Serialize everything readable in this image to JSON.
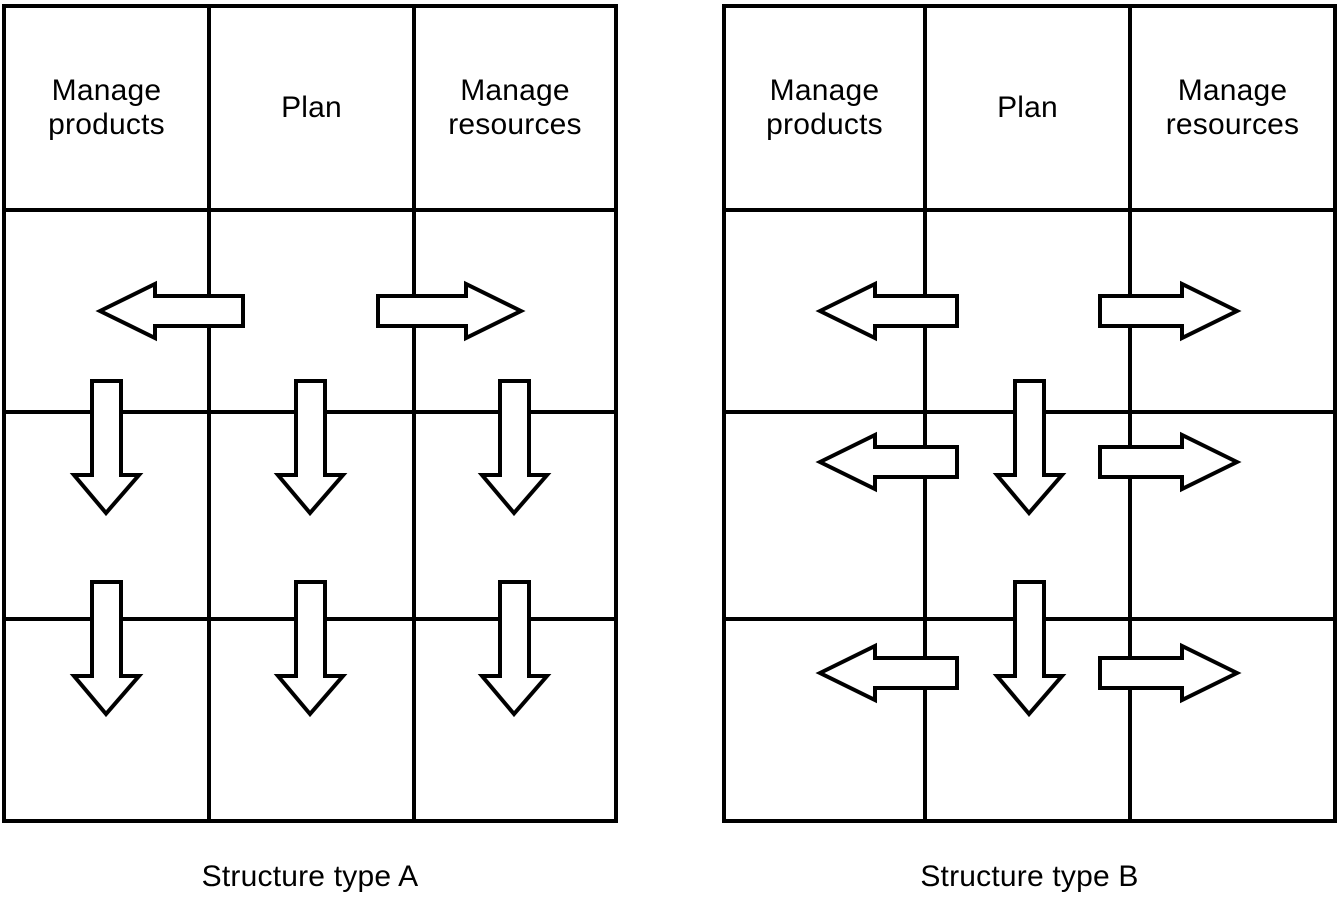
{
  "diagram": {
    "title_visible": false,
    "line_color": "#000000",
    "fill_color": "#ffffff",
    "panels": [
      {
        "id": "structure-type-a",
        "caption": "Structure type A",
        "columns": [
          "Manage products",
          "Plan",
          "Manage resources"
        ],
        "column_lines": [
          "Manage\nproducts",
          "Plan",
          "Manage\nresources"
        ],
        "rows": 4,
        "arrows": [
          {
            "kind": "left",
            "row": 2,
            "from_column": "Plan",
            "to_column": "Manage products"
          },
          {
            "kind": "right",
            "row": 2,
            "from_column": "Plan",
            "to_column": "Manage resources"
          },
          {
            "kind": "down",
            "row": "2-3",
            "column": "Manage products"
          },
          {
            "kind": "down",
            "row": "2-3",
            "column": "Plan"
          },
          {
            "kind": "down",
            "row": "2-3",
            "column": "Manage resources"
          },
          {
            "kind": "down",
            "row": "3-4",
            "column": "Manage products"
          },
          {
            "kind": "down",
            "row": "3-4",
            "column": "Plan"
          },
          {
            "kind": "down",
            "row": "3-4",
            "column": "Manage resources"
          }
        ]
      },
      {
        "id": "structure-type-b",
        "caption": "Structure type B",
        "columns": [
          "Manage products",
          "Plan",
          "Manage resources"
        ],
        "column_lines": [
          "Manage\nproducts",
          "Plan",
          "Manage\nresources"
        ],
        "rows": 4,
        "arrows": [
          {
            "kind": "left",
            "row": 2,
            "from_column": "Plan",
            "to_column": "Manage products"
          },
          {
            "kind": "right",
            "row": 2,
            "from_column": "Plan",
            "to_column": "Manage resources"
          },
          {
            "kind": "down",
            "row": "2-3",
            "column": "Plan"
          },
          {
            "kind": "left",
            "row": 3,
            "from_column": "Plan",
            "to_column": "Manage products"
          },
          {
            "kind": "right",
            "row": 3,
            "from_column": "Plan",
            "to_column": "Manage resources"
          },
          {
            "kind": "down",
            "row": "3-4",
            "column": "Plan"
          },
          {
            "kind": "left",
            "row": 4,
            "from_column": "Plan",
            "to_column": "Manage products"
          },
          {
            "kind": "right",
            "row": 4,
            "from_column": "Plan",
            "to_column": "Manage resources"
          }
        ]
      }
    ]
  },
  "panel_a": {
    "header": {
      "col1_line1": "Manage",
      "col1_line2": "products",
      "col2_line1": "Plan",
      "col3_line1": "Manage",
      "col3_line2": "resources"
    },
    "caption": "Structure type A"
  },
  "panel_b": {
    "header": {
      "col1_line1": "Manage",
      "col1_line2": "products",
      "col2_line1": "Plan",
      "col3_line1": "Manage",
      "col3_line2": "resources"
    },
    "caption": "Structure type B"
  }
}
